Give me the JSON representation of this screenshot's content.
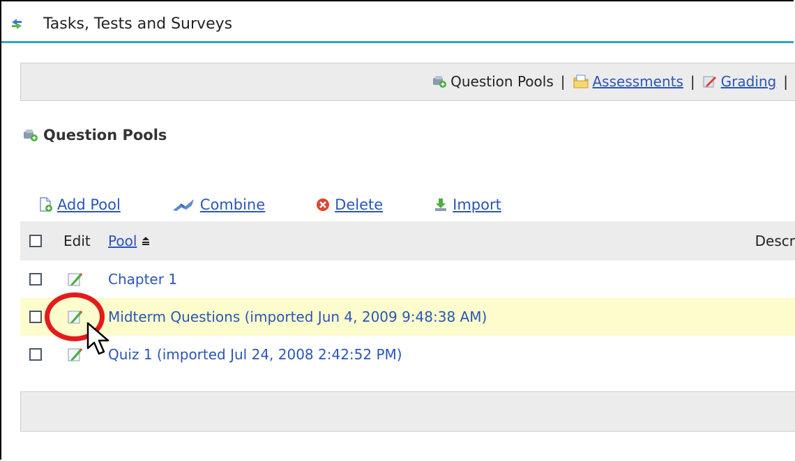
{
  "header": {
    "title": "Tasks, Tests and Surveys",
    "icon": "refresh-arrows-icon"
  },
  "nav": {
    "items": [
      {
        "label": "Question Pools",
        "icon": "question-pools-icon",
        "link": false
      },
      {
        "label": "Assessments",
        "icon": "assessments-icon",
        "link": true
      },
      {
        "label": "Grading",
        "icon": "grading-icon",
        "link": true
      }
    ],
    "separator": "|"
  },
  "section": {
    "title": "Question Pools",
    "icon": "question-pools-icon"
  },
  "actions": {
    "add_pool": "Add Pool",
    "combine": "Combine",
    "delete": "Delete",
    "import": "Import"
  },
  "table": {
    "headers": {
      "edit": "Edit",
      "pool": "Pool",
      "description": "Descr"
    },
    "rows": [
      {
        "name": "Chapter 1"
      },
      {
        "name": "Midterm Questions (imported Jun 4, 2009 9:48:38 AM)"
      },
      {
        "name": "Quiz 1 (imported Jul 24, 2008 2:42:52 PM)"
      }
    ]
  },
  "colors": {
    "accent_line": "#29a3d3",
    "link": "#2a55b8",
    "highlight_row": "#fcfccc",
    "annotation": "#e51b1b"
  }
}
